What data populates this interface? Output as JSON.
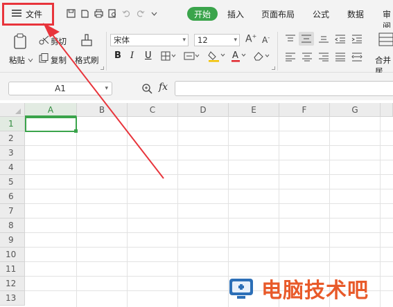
{
  "toolbar": {
    "file_label": "文件",
    "tabs": [
      "开始",
      "插入",
      "页面布局",
      "公式",
      "数据",
      "审阅"
    ]
  },
  "ribbon": {
    "paste_label": "粘贴",
    "cut_label": "剪切",
    "copy_label": "复制",
    "format_painter_label": "格式刷",
    "font_name": "宋体",
    "font_size": "12",
    "merge_label": "合并居"
  },
  "formula": {
    "name_box": "A1",
    "fx_label": "fx"
  },
  "sheet": {
    "columns": [
      "A",
      "B",
      "C",
      "D",
      "E",
      "F",
      "G"
    ],
    "rows": [
      "1",
      "2",
      "3",
      "4",
      "5",
      "6",
      "7",
      "8",
      "9",
      "10",
      "11",
      "12",
      "13"
    ],
    "selected_cell": "A1"
  },
  "watermark": {
    "text": "电脑技术吧"
  },
  "colors": {
    "accent": "#3aa44b",
    "highlight": "#e8343b"
  }
}
